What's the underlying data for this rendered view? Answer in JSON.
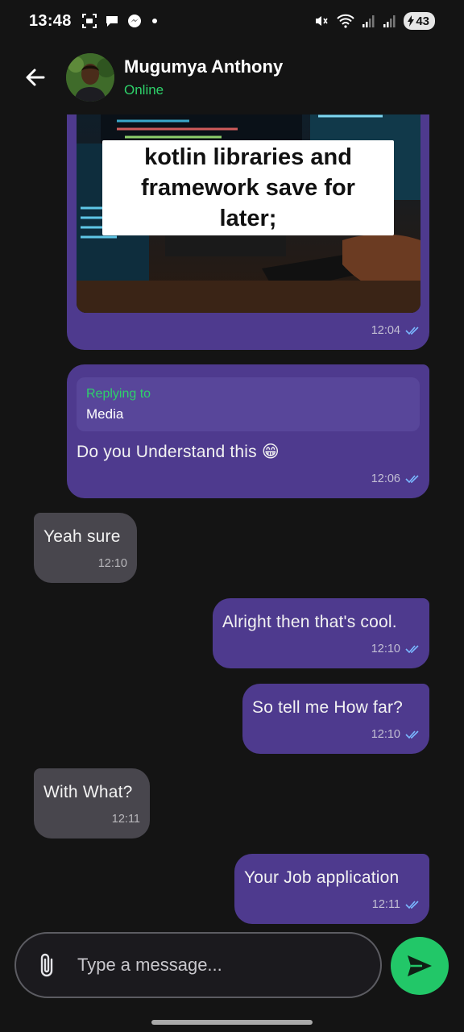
{
  "status_bar": {
    "time": "13:48",
    "battery": "43"
  },
  "header": {
    "contact_name": "Mugumya Anthony",
    "contact_status": "Online"
  },
  "messages": [
    {
      "type": "image",
      "direction": "sent",
      "image_caption": "kotlin libraries and framework save for later;",
      "time": "12:04"
    },
    {
      "type": "reply",
      "direction": "sent",
      "reply_label": "Replying to",
      "reply_target": "Media",
      "text": "Do you Understand this 😁",
      "time": "12:06"
    },
    {
      "type": "text",
      "direction": "received",
      "text": "Yeah sure",
      "time": "12:10"
    },
    {
      "type": "text",
      "direction": "sent",
      "text": "Alright then that's cool.",
      "time": "12:10"
    },
    {
      "type": "text",
      "direction": "sent",
      "text": "So tell me How far?",
      "time": "12:10"
    },
    {
      "type": "text",
      "direction": "received",
      "text": "With What?",
      "time": "12:11"
    },
    {
      "type": "text",
      "direction": "sent",
      "text": "Your Job application",
      "time": "12:11"
    }
  ],
  "composer": {
    "placeholder": "Type a message..."
  },
  "colors": {
    "sent_bubble": "#4e3a8e",
    "received_bubble": "#48464d",
    "accent_green": "#22c768",
    "online_green": "#2ed16a"
  }
}
